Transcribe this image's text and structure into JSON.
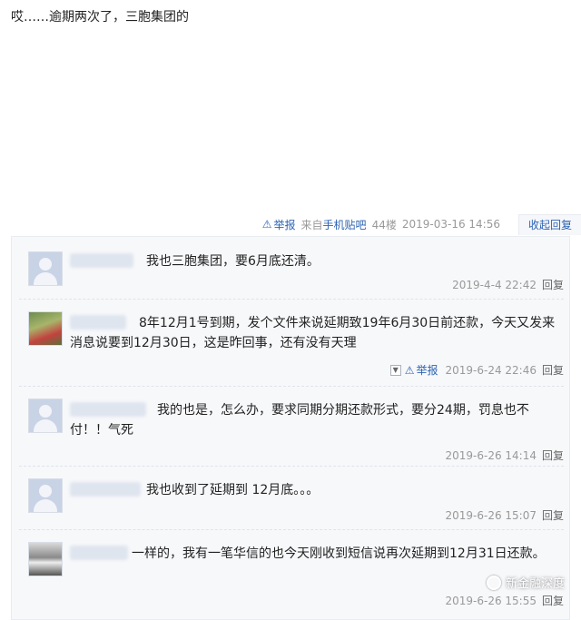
{
  "post": {
    "text": "哎……逾期两次了，三胞集团的",
    "report_label": "举报",
    "source_prefix": "来自",
    "source_link": "手机贴吧",
    "floor": "44楼",
    "time": "2019-03-16 14:56",
    "collapse_label": "收起回复"
  },
  "replies": [
    {
      "text": "我也三胞集团，要6月底还清。",
      "time": "2019-4-4 22:42",
      "reply_label": "回复"
    },
    {
      "text": "8年12月1号到期，发个文件来说延期致19年6月30日前还款，今天又发来消息说要到12月30日，这是昨回事，还有没有天理",
      "report_label": "举报",
      "time": "2019-6-24 22:46",
      "reply_label": "回复"
    },
    {
      "text": "我的也是，怎么办，要求同期分期还款形式，要分24期，罚息也不付！！气死",
      "time": "2019-6-26 14:14",
      "reply_label": "回复"
    },
    {
      "text": "我也收到了延期到 12月底。。。",
      "time": "2019-6-26 15:07",
      "reply_label": "回复"
    },
    {
      "text": "一样的，我有一笔华信的也今天刚收到短信说再次延期到12月31日还款。",
      "time": "2019-6-26 15:55",
      "reply_label": "回复"
    }
  ],
  "watermark": "新金融深度",
  "colors": {
    "link": "#2d64b3",
    "muted": "#999999",
    "reply_bg": "#f7f8fa"
  },
  "icons": [
    "warning-icon",
    "default-avatar-icon",
    "dropdown-icon",
    "wechat-logo-icon"
  ]
}
